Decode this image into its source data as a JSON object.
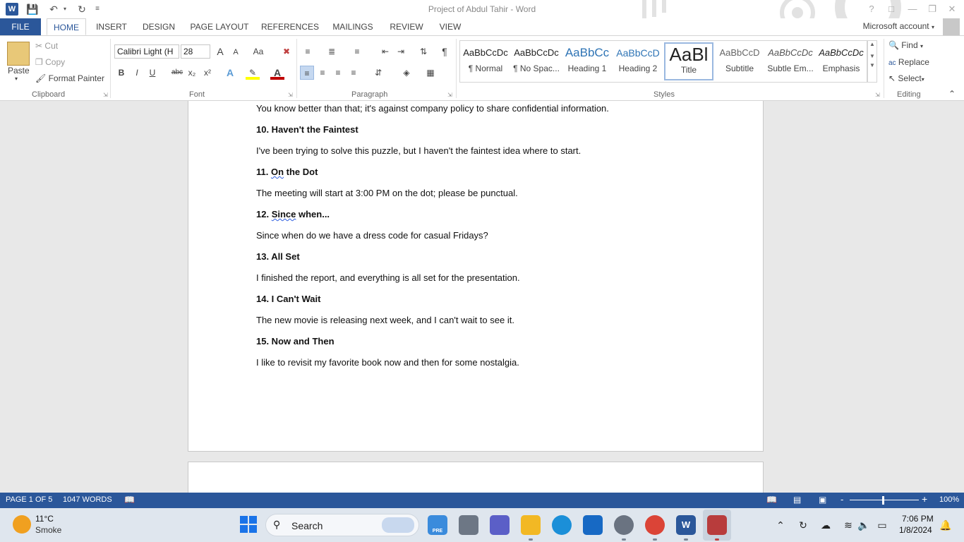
{
  "window": {
    "title": "Project of Abdul Tahir - Word",
    "account": "Microsoft account"
  },
  "tabs": [
    {
      "label": "FILE"
    },
    {
      "label": "HOME"
    },
    {
      "label": "INSERT"
    },
    {
      "label": "DESIGN"
    },
    {
      "label": "PAGE LAYOUT"
    },
    {
      "label": "REFERENCES"
    },
    {
      "label": "MAILINGS"
    },
    {
      "label": "REVIEW"
    },
    {
      "label": "VIEW"
    }
  ],
  "clipboard": {
    "paste": "Paste",
    "cut": "Cut",
    "copy": "Copy",
    "format_painter": "Format Painter",
    "label": "Clipboard"
  },
  "font": {
    "name": "Calibri Light (H",
    "size": "28",
    "label": "Font",
    "case": "Aa",
    "bold": "B",
    "italic": "I",
    "underline": "U",
    "strike": "abc",
    "sub": "x₂",
    "sup": "x²",
    "grow": "A",
    "shrink": "A",
    "effects": "A",
    "color": "A"
  },
  "paragraph": {
    "label": "Paragraph",
    "pilcrow": "¶"
  },
  "styles": {
    "label": "Styles",
    "items": [
      {
        "preview": "AaBbCcDc",
        "name": "¶ Normal"
      },
      {
        "preview": "AaBbCcDc",
        "name": "¶ No Spac..."
      },
      {
        "preview": "AaBbCc",
        "name": "Heading 1"
      },
      {
        "preview": "AaBbCcD",
        "name": "Heading 2"
      },
      {
        "preview": "AaBl",
        "name": "Title"
      },
      {
        "preview": "AaBbCcD",
        "name": "Subtitle"
      },
      {
        "preview": "AaBbCcDc",
        "name": "Subtle Em..."
      },
      {
        "preview": "AaBbCcDc",
        "name": "Emphasis"
      }
    ]
  },
  "editing": {
    "label": "Editing",
    "find": "Find",
    "replace": "Replace",
    "select": "Select"
  },
  "document": {
    "lines": [
      {
        "text": "You know better than that; it's against company policy to share confidential information.",
        "bold": false
      },
      {
        "text": "10. Haven't the Faintest",
        "bold": true
      },
      {
        "text": "I've been trying to solve this puzzle, but I haven't the faintest idea where to start.",
        "bold": false
      },
      {
        "num": "11. ",
        "squig": "On",
        "rest": " the Dot",
        "bold": true
      },
      {
        "text": "The meeting will start at 3:00 PM on the dot; please be punctual.",
        "bold": false
      },
      {
        "num": "12. ",
        "squig": "Since",
        "rest": " when...",
        "bold": true
      },
      {
        "text": "Since when do we have a dress code for casual Fridays?",
        "bold": false
      },
      {
        "text": "13. All Set",
        "bold": true
      },
      {
        "text": "I finished the report, and everything is all set for the presentation.",
        "bold": false
      },
      {
        "text": "14. I Can't Wait",
        "bold": true
      },
      {
        "text": "The new movie is releasing next week, and I can't wait to see it.",
        "bold": false
      },
      {
        "text": "15. Now and Then",
        "bold": true
      },
      {
        "text": "I like to revisit my favorite book now and then for some nostalgia.",
        "bold": false
      }
    ]
  },
  "status": {
    "page": "PAGE 1 OF 5",
    "words": "1047 WORDS",
    "zoom": "100%",
    "zoom_minus": "-",
    "zoom_plus": "+"
  },
  "taskbar": {
    "temp": "11°C",
    "condition": "Smoke",
    "search": "Search",
    "time": "7:06 PM",
    "date": "1/8/2024",
    "pre_badge": "PRE"
  },
  "colors": {
    "accent": "#2b579a",
    "status_bar": "#2b579a",
    "font_color": "#c00000",
    "highlight": "#ffff00"
  }
}
